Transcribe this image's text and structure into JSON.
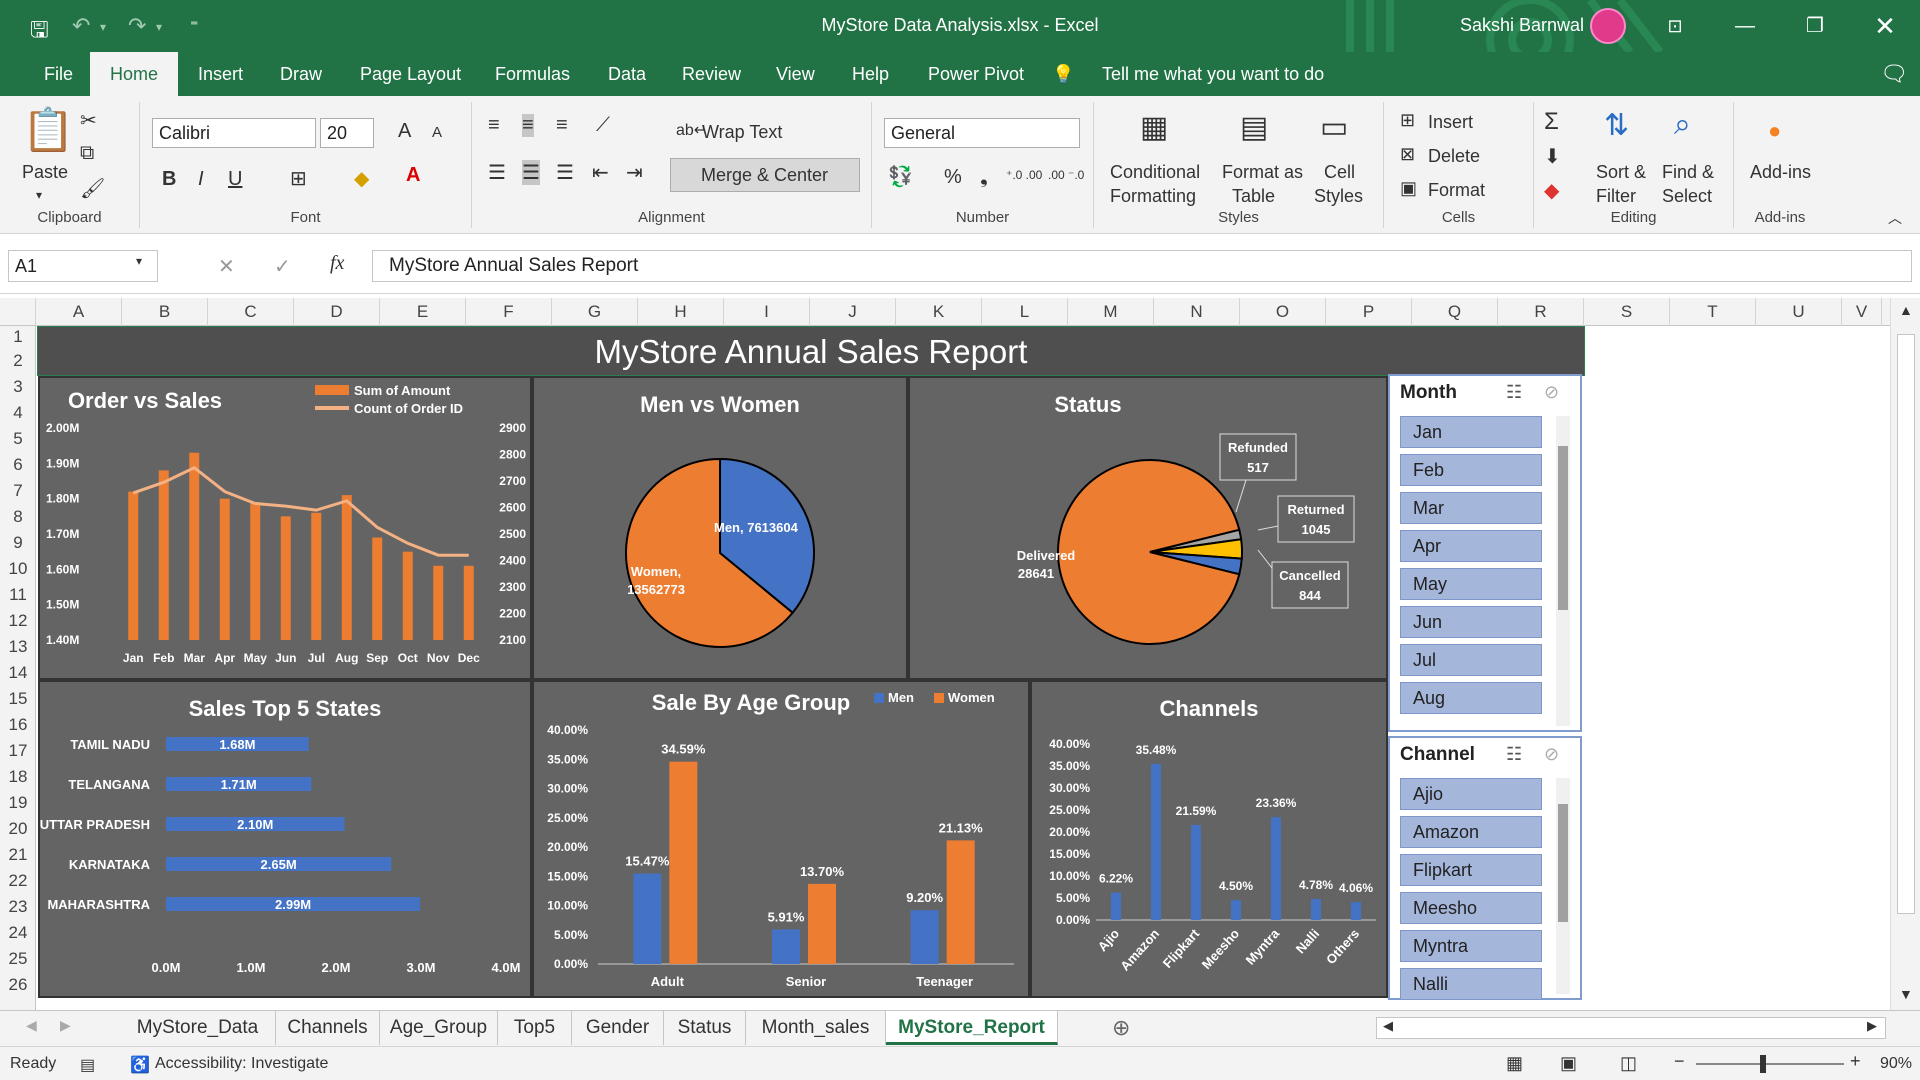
{
  "titlebar": {
    "title": "MyStore Data Analysis.xlsx  -  Excel",
    "user": "Sakshi Barnwal",
    "qat_more": "⁼"
  },
  "ribbon_tabs": [
    "File",
    "Home",
    "Insert",
    "Draw",
    "Page Layout",
    "Formulas",
    "Data",
    "Review",
    "View",
    "Help",
    "Power Pivot",
    "Tell me what you want to do"
  ],
  "ribbon": {
    "clipboard": {
      "paste": "Paste",
      "label": "Clipboard"
    },
    "font": {
      "name": "Calibri",
      "size": "20",
      "bold": "B",
      "italic": "I",
      "underline": "U",
      "grow": "A",
      "shrink": "A",
      "label": "Font"
    },
    "alignment": {
      "wrap": "Wrap Text",
      "merge": "Merge & Center",
      "label": "Alignment"
    },
    "number": {
      "format": "General",
      "percent": "%",
      "comma": "❟",
      "inc": "⁺.0 .00",
      "dec": ".00 ⁻.0",
      "label": "Number"
    },
    "styles": {
      "cond1": "Conditional",
      "cond2": "Formatting",
      "fmt1": "Format as",
      "fmt2": "Table",
      "cell1": "Cell",
      "cell2": "Styles",
      "label": "Styles"
    },
    "cells": {
      "insert": "Insert",
      "delete": "Delete",
      "format": "Format",
      "label": "Cells"
    },
    "editing": {
      "sort1": "Sort &",
      "sort2": "Filter",
      "find1": "Find &",
      "find2": "Select",
      "label": "Editing"
    },
    "addins": {
      "btn": "Add-ins",
      "label": "Add-ins"
    }
  },
  "formula": {
    "namebox": "A1",
    "fx": "fx",
    "value": "MyStore Annual Sales Report"
  },
  "columns": [
    "A",
    "B",
    "C",
    "D",
    "E",
    "F",
    "G",
    "H",
    "I",
    "J",
    "K",
    "L",
    "M",
    "N",
    "O",
    "P",
    "Q",
    "R",
    "S",
    "T",
    "U",
    "V"
  ],
  "rows": [
    "1",
    "2",
    "3",
    "4",
    "5",
    "6",
    "7",
    "8",
    "9",
    "10",
    "11",
    "12",
    "13",
    "14",
    "15",
    "16",
    "17",
    "18",
    "19",
    "20",
    "21",
    "22",
    "23",
    "24",
    "25",
    "26"
  ],
  "report_title": "MyStore Annual Sales Report",
  "charts": {
    "order_vs_sales": {
      "title": "Order vs Sales",
      "legend": [
        "Sum of Amount",
        "Count of Order ID"
      ]
    },
    "men_vs_women": {
      "title": "Men vs Women",
      "labels": [
        "Men, 7613604",
        "Women,",
        "13562773"
      ]
    },
    "status": {
      "title": "Status",
      "labels": {
        "refunded": [
          "Refunded",
          "517"
        ],
        "returned": [
          "Returned",
          "1045"
        ],
        "cancelled": [
          "Cancelled",
          "844"
        ],
        "delivered": [
          "Delivered",
          "28641"
        ]
      }
    },
    "top5": {
      "title": "Sales Top 5 States"
    },
    "age": {
      "title": "Sale By Age Group",
      "legend": [
        "Men",
        "Women"
      ]
    },
    "channels": {
      "title": "Channels"
    }
  },
  "chart_data": [
    {
      "type": "bar",
      "title": "Order vs Sales",
      "categories": [
        "Jan",
        "Feb",
        "Mar",
        "Apr",
        "May",
        "Jun",
        "Jul",
        "Aug",
        "Sep",
        "Oct",
        "Nov",
        "Dec"
      ],
      "series": [
        {
          "name": "Sum of Amount",
          "values": [
            1.82,
            1.88,
            1.93,
            1.8,
            1.79,
            1.75,
            1.76,
            1.81,
            1.69,
            1.65,
            1.61,
            1.61
          ]
        },
        {
          "name": "Count of Order ID",
          "values": [
            2655,
            2695,
            2750,
            2660,
            2615,
            2605,
            2590,
            2625,
            2525,
            2465,
            2420,
            2420
          ]
        }
      ],
      "y_ticks": [
        "1.40M",
        "1.50M",
        "1.60M",
        "1.70M",
        "1.80M",
        "1.90M",
        "2.00M"
      ],
      "ylim": [
        1.4,
        2.0
      ],
      "y2_ticks": [
        "2100",
        "2200",
        "2300",
        "2400",
        "2500",
        "2600",
        "2700",
        "2800",
        "2900"
      ],
      "y2lim": [
        2100,
        2900
      ]
    },
    {
      "type": "pie",
      "title": "Men vs Women",
      "categories": [
        "Men",
        "Women"
      ],
      "values": [
        7613604,
        13562773
      ]
    },
    {
      "type": "pie",
      "title": "Status",
      "categories": [
        "Delivered",
        "Refunded",
        "Returned",
        "Cancelled"
      ],
      "values": [
        28641,
        517,
        1045,
        844
      ]
    },
    {
      "type": "bar",
      "title": "Sales Top 5 States",
      "categories": [
        "TAMIL NADU",
        "TELANGANA",
        "UTTAR PRADESH",
        "KARNATAKA",
        "MAHARASHTRA"
      ],
      "values": [
        1.68,
        1.71,
        2.1,
        2.65,
        2.99
      ],
      "labels": [
        "1.68M",
        "1.71M",
        "2.10M",
        "2.65M",
        "2.99M"
      ],
      "x_ticks": [
        "0.0M",
        "1.0M",
        "2.0M",
        "3.0M",
        "4.0M"
      ],
      "xlim": [
        0,
        4
      ]
    },
    {
      "type": "bar",
      "title": "Sale By Age Group",
      "categories": [
        "Adult",
        "Senior",
        "Teenager"
      ],
      "series": [
        {
          "name": "Men",
          "values": [
            15.47,
            5.91,
            9.2
          ],
          "labels": [
            "15.47%",
            "5.91%",
            "9.20%"
          ]
        },
        {
          "name": "Women",
          "values": [
            34.59,
            13.7,
            21.13
          ],
          "labels": [
            "34.59%",
            "13.70%",
            "21.13%"
          ]
        }
      ],
      "y_ticks": [
        "0.00%",
        "5.00%",
        "10.00%",
        "15.00%",
        "20.00%",
        "25.00%",
        "30.00%",
        "35.00%",
        "40.00%"
      ],
      "ylim": [
        0,
        40
      ]
    },
    {
      "type": "bar",
      "title": "Channels",
      "categories": [
        "Ajio",
        "Amazon",
        "Flipkart",
        "Meesho",
        "Myntra",
        "Nalli",
        "Others"
      ],
      "values": [
        6.22,
        35.48,
        21.59,
        4.5,
        23.36,
        4.78,
        4.06
      ],
      "labels": [
        "6.22%",
        "35.48%",
        "21.59%",
        "4.50%",
        "23.36%",
        "4.78%",
        "4.06%"
      ],
      "y_ticks": [
        "0.00%",
        "5.00%",
        "10.00%",
        "15.00%",
        "20.00%",
        "25.00%",
        "30.00%",
        "35.00%",
        "40.00%"
      ],
      "ylim": [
        0,
        40
      ]
    }
  ],
  "slicers": {
    "month": {
      "title": "Month",
      "items": [
        "Jan",
        "Feb",
        "Mar",
        "Apr",
        "May",
        "Jun",
        "Jul",
        "Aug"
      ]
    },
    "channel": {
      "title": "Channel",
      "items": [
        "Ajio",
        "Amazon",
        "Flipkart",
        "Meesho",
        "Myntra",
        "Nalli"
      ]
    }
  },
  "sheet_tabs": [
    "MyStore_Data",
    "Channels",
    "Age_Group",
    "Top5",
    "Gender",
    "Status",
    "Month_sales",
    "MyStore_Report"
  ],
  "status": {
    "ready": "Ready",
    "accessibility": "Accessibility: Investigate",
    "zoom": "90%",
    "minus": "−",
    "plus": "+"
  },
  "colors": {
    "excel_green": "#217346",
    "orange": "#ED7D31",
    "blue": "#4472C4",
    "gray_panel": "#646464",
    "yellow": "#FFC000"
  }
}
